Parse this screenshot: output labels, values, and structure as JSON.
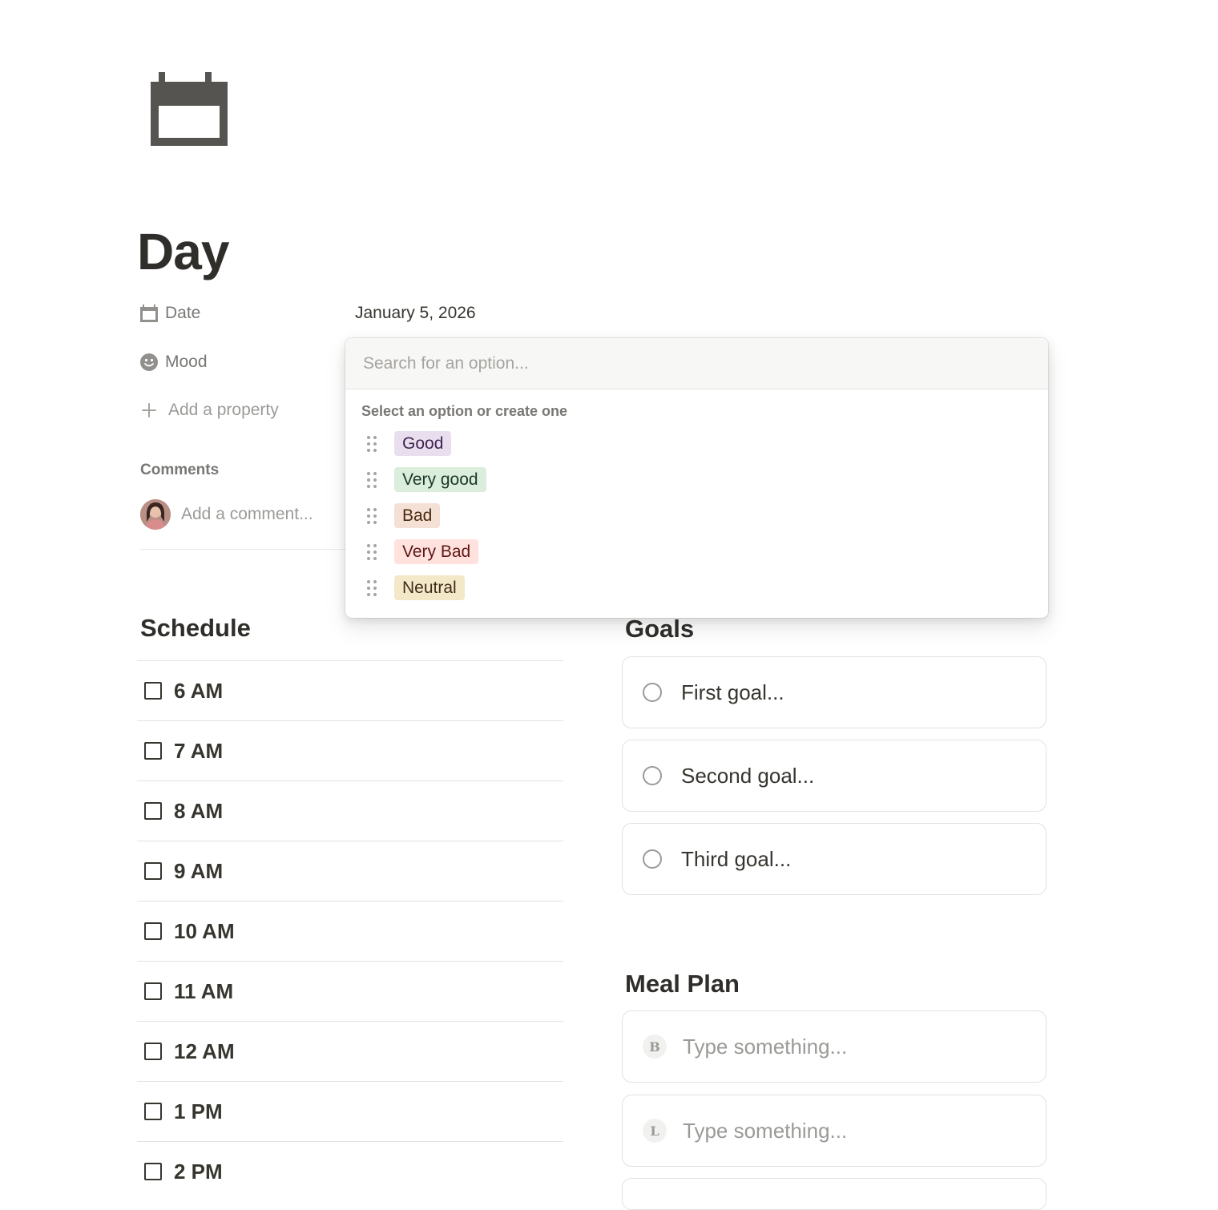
{
  "page": {
    "icon": "calendar-icon",
    "title": "Day"
  },
  "properties": {
    "date": {
      "label": "Date",
      "icon": "calendar-small-icon",
      "value": "January 5, 2026"
    },
    "mood": {
      "label": "Mood",
      "icon": "smiley-icon"
    },
    "add_property": "Add a property"
  },
  "comments": {
    "label": "Comments",
    "placeholder": "Add a comment..."
  },
  "schedule": {
    "heading": "Schedule",
    "items": [
      "6 AM",
      "7 AM",
      "8 AM",
      "9 AM",
      "10 AM",
      "11 AM",
      "12 AM",
      "1 PM",
      "2 PM"
    ]
  },
  "goals": {
    "heading": "Goals",
    "items": [
      "First goal...",
      "Second goal...",
      "Third goal..."
    ]
  },
  "meal_plan": {
    "heading": "Meal Plan",
    "items": [
      {
        "badge": "B",
        "placeholder": "Type something..."
      },
      {
        "badge": "L",
        "placeholder": "Type something..."
      }
    ]
  },
  "mood_dropdown": {
    "search_placeholder": "Search for an option...",
    "hint": "Select an option or create one",
    "options": [
      {
        "label": "Good",
        "bg": "#e8deee",
        "fg": "#412454"
      },
      {
        "label": "Very good",
        "bg": "#dbeddb",
        "fg": "#1c3829"
      },
      {
        "label": "Bad",
        "bg": "#f5e0d6",
        "fg": "#49290e"
      },
      {
        "label": "Very Bad",
        "bg": "#ffe2dd",
        "fg": "#5d1715"
      },
      {
        "label": "Neutral",
        "bg": "#f3e8c8",
        "fg": "#402c1b"
      }
    ]
  }
}
